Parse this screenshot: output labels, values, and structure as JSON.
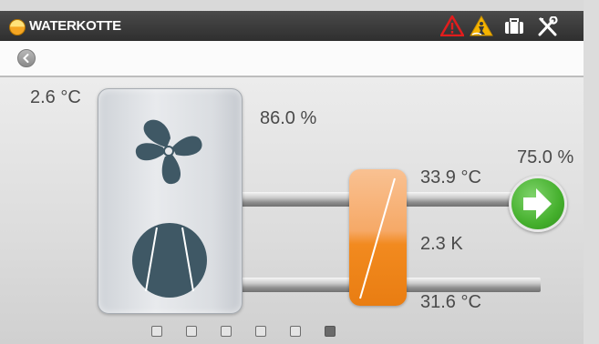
{
  "header": {
    "brand": "WATERKOTTE",
    "icons": [
      "alarm-triangle-icon",
      "warning-wet-floor-icon",
      "briefcase-icon",
      "tools-icon"
    ]
  },
  "toolbar": {
    "back_icon": "back-arrow-icon"
  },
  "readings": {
    "outdoor_temp": "2.6 °C",
    "fan_speed": "86.0 %",
    "output_percent": "75.0 %",
    "supply_temp": "33.9 °C",
    "delta": "2.3 K",
    "return_temp": "31.6 °C"
  },
  "colors": {
    "header_bg": "#3a3a3a",
    "accent_orange": "#f28a1f",
    "go_green": "#45b02d",
    "icon_slate": "#3f5865",
    "alarm_red": "#e21d1d",
    "warning_yellow": "#f5b400"
  },
  "pager": {
    "pages": 6,
    "active_index": 5
  }
}
